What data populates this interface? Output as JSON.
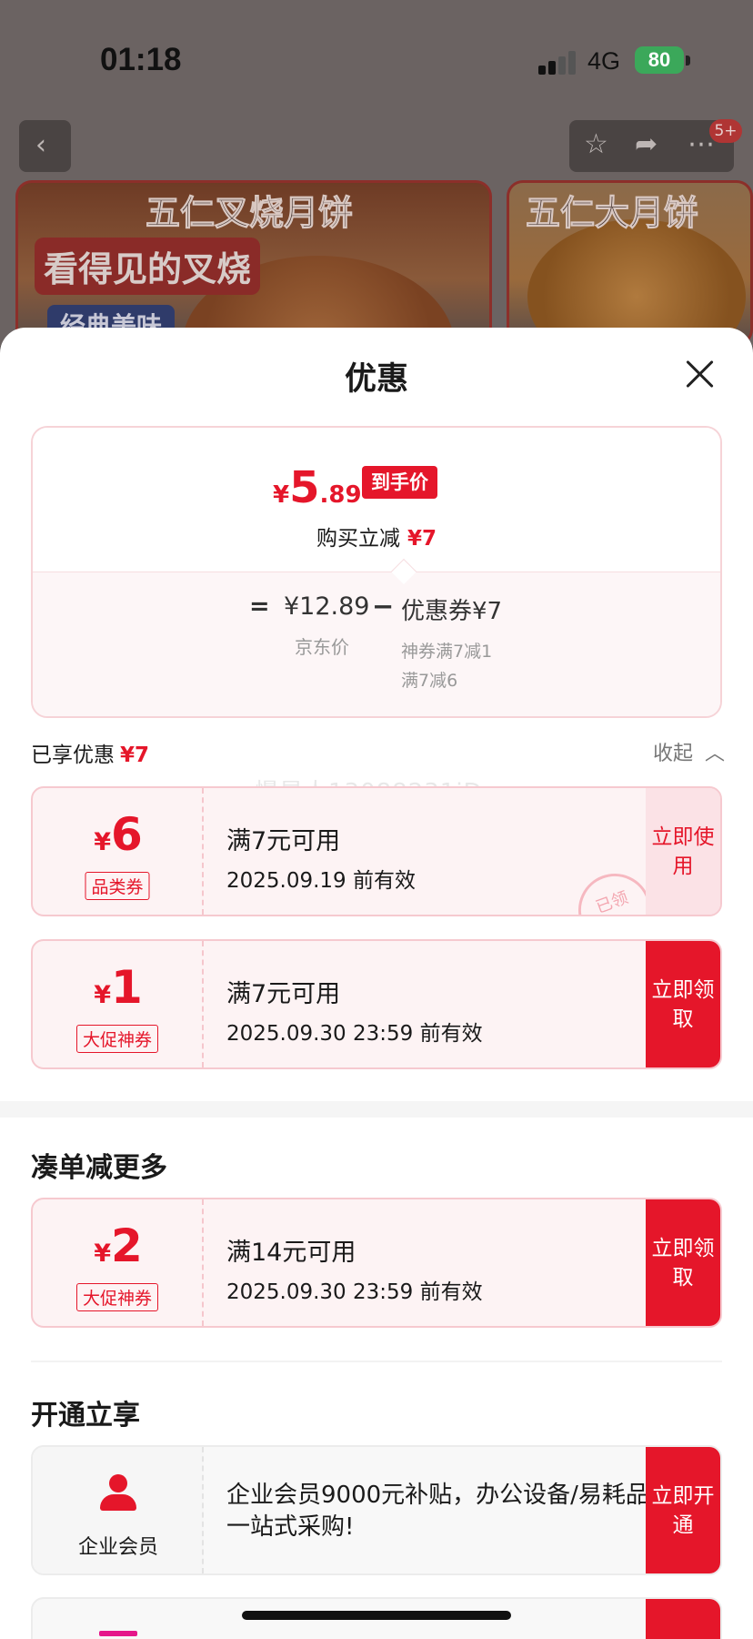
{
  "status_bar": {
    "time": "01:18",
    "network": "4G",
    "battery": "80"
  },
  "nav": {
    "back_icon": "chevron-left-icon",
    "badge": "5+"
  },
  "banners": [
    {
      "title": "五仁叉烧月饼",
      "tag": "看得见的叉烧",
      "sub": "经典美味"
    },
    {
      "title": "五仁大月饼"
    }
  ],
  "sheet": {
    "title": "优惠"
  },
  "price": {
    "yen": "¥",
    "integer": "5",
    "decimal": ".89",
    "tag": "到手价",
    "buy_reduce_label": "购买立减",
    "buy_reduce_value": "¥7",
    "equals": "=",
    "jd_price": "¥12.89",
    "jd_label": "京东价",
    "minus": "−",
    "coupon_total": "优惠券¥7",
    "coupon_lines": [
      "神券满7减1",
      "满7减6"
    ]
  },
  "enjoyed": {
    "label": "已享优惠",
    "value": "¥7",
    "collapse": "收起"
  },
  "watermark": "慢星人13088231jD",
  "coupons": [
    {
      "yen": "¥",
      "amount": "6",
      "type": "品类券",
      "condition": "满7元可用",
      "expiry": "2025.09.19 前有效",
      "action": "立即使用",
      "used": true,
      "stamp": "已领"
    },
    {
      "yen": "¥",
      "amount": "1",
      "type": "大促神券",
      "condition": "满7元可用",
      "expiry": "2025.09.30 23:59 前有效",
      "action": "立即领取",
      "used": false
    }
  ],
  "more": {
    "title": "凑单减更多",
    "coupon": {
      "yen": "¥",
      "amount": "2",
      "type": "大促神券",
      "condition": "满14元可用",
      "expiry": "2025.09.30 23:59 前有效",
      "action": "立即领取"
    }
  },
  "open": {
    "title": "开通立享",
    "member": {
      "label": "企业会员",
      "desc": "企业会员9000元补贴，办公设备/易耗品一站式采购!",
      "action": "立即开通",
      "icon": "person-icon"
    }
  },
  "colors": {
    "accent": "#e5162a",
    "pink_border": "#f6c9cf",
    "coupon_bg": "#fdf3f4"
  }
}
